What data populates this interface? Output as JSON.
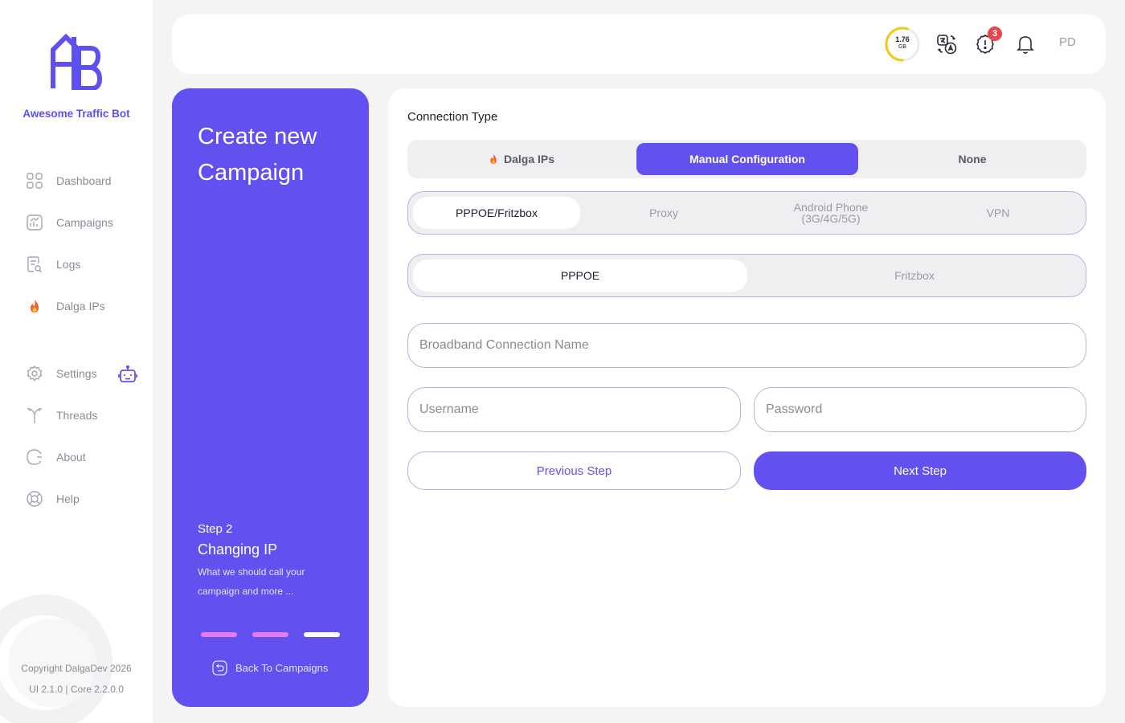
{
  "brand": {
    "name": "Awesome Traffic Bot"
  },
  "sidebar": {
    "items": [
      {
        "label": "Dashboard",
        "icon": "dashboard-grid-icon"
      },
      {
        "label": "Campaigns",
        "icon": "campaigns-chart-icon"
      },
      {
        "label": "Logs",
        "icon": "logs-icon"
      },
      {
        "label": "Dalga IPs",
        "icon": "fire-icon"
      },
      {
        "label": "Settings",
        "icon": "gear-icon"
      },
      {
        "label": "Threads",
        "icon": "threads-icon"
      },
      {
        "label": "About",
        "icon": "about-icon"
      },
      {
        "label": "Help",
        "icon": "help-lifebuoy-icon"
      }
    ],
    "copyright": "Copyright DalgaDev 2026",
    "version": "UI 2.1.0 | Core 2.2.0.0"
  },
  "topbar": {
    "usage_value": "1.76",
    "usage_unit": "GB",
    "usage_fraction": 0.55,
    "alert_count": "3",
    "avatar_initials": "PD"
  },
  "panel": {
    "title": "Create new Campaign",
    "step_number": "Step 2",
    "step_title": "Changing IP",
    "step_description": "What we should call your campaign and more ...",
    "steps_total": 3,
    "current_step": 3,
    "back_label": "Back To Campaigns"
  },
  "form": {
    "connection_type_label": "Connection Type",
    "connection_types": [
      {
        "label": "Dalga IPs",
        "active": false
      },
      {
        "label": "Manual Configuration",
        "active": true
      },
      {
        "label": "None",
        "active": false
      }
    ],
    "methods": [
      {
        "label": "PPPOE/Fritzbox",
        "active": true
      },
      {
        "label": "Proxy",
        "active": false
      },
      {
        "label": "Android Phone",
        "sublabel": "(3G/4G/5G)",
        "active": false
      },
      {
        "label": "VPN",
        "active": false
      }
    ],
    "submethods": [
      {
        "label": "PPPOE",
        "active": true
      },
      {
        "label": "Fritzbox",
        "active": false
      }
    ],
    "connection_name_placeholder": "Broadband Connection Name",
    "username_placeholder": "Username",
    "password_placeholder": "Password",
    "previous_label": "Previous Step",
    "next_label": "Next Step"
  },
  "colors": {
    "primary": "#6251ee",
    "step_done": "#e67cf0",
    "step_current": "#ffffff",
    "badge": "#e8484d",
    "gauge_track": "#ececef",
    "gauge_fill": "#f5c518"
  }
}
